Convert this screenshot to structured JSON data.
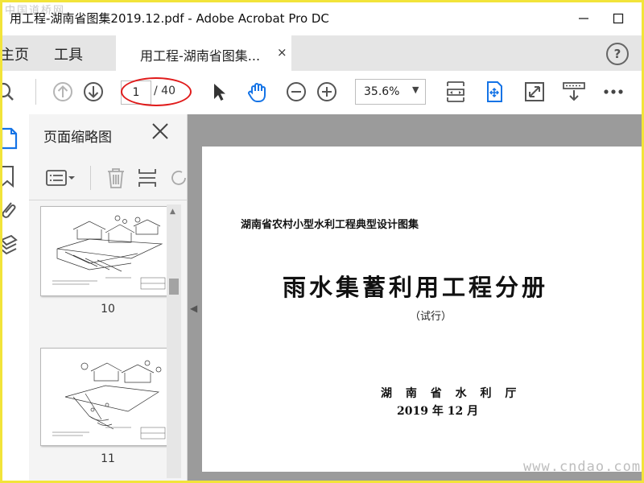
{
  "window": {
    "title": "用工程-湖南省图集2019.12.pdf - Adobe Acrobat Pro DC",
    "watermark_top": "中国道桥网"
  },
  "nav": {
    "home_label": "主页",
    "tools_label": "工具"
  },
  "tab": {
    "label": "用工程-湖南省图集...",
    "close": "×"
  },
  "help": "?",
  "toolbar": {
    "current_page": "1",
    "total_pages": "/ 40",
    "zoom": "35.6%"
  },
  "thumbnails_panel": {
    "title": "页面缩略图",
    "pages": [
      {
        "number": "10"
      },
      {
        "number": "11"
      }
    ]
  },
  "document": {
    "header": "湖南省农村小型水利工程典型设计图集",
    "title": "雨水集蓄利用工程分册",
    "subtitle": "（试行）",
    "organization": "湖 南 省 水 利 厅",
    "date": "2019 年 12 月"
  },
  "watermark_bottom": "www.cndao.com",
  "colors": {
    "accent_blue": "#1473e6",
    "highlight_red": "#e01b1b",
    "frame_yellow": "#f2e43a"
  }
}
